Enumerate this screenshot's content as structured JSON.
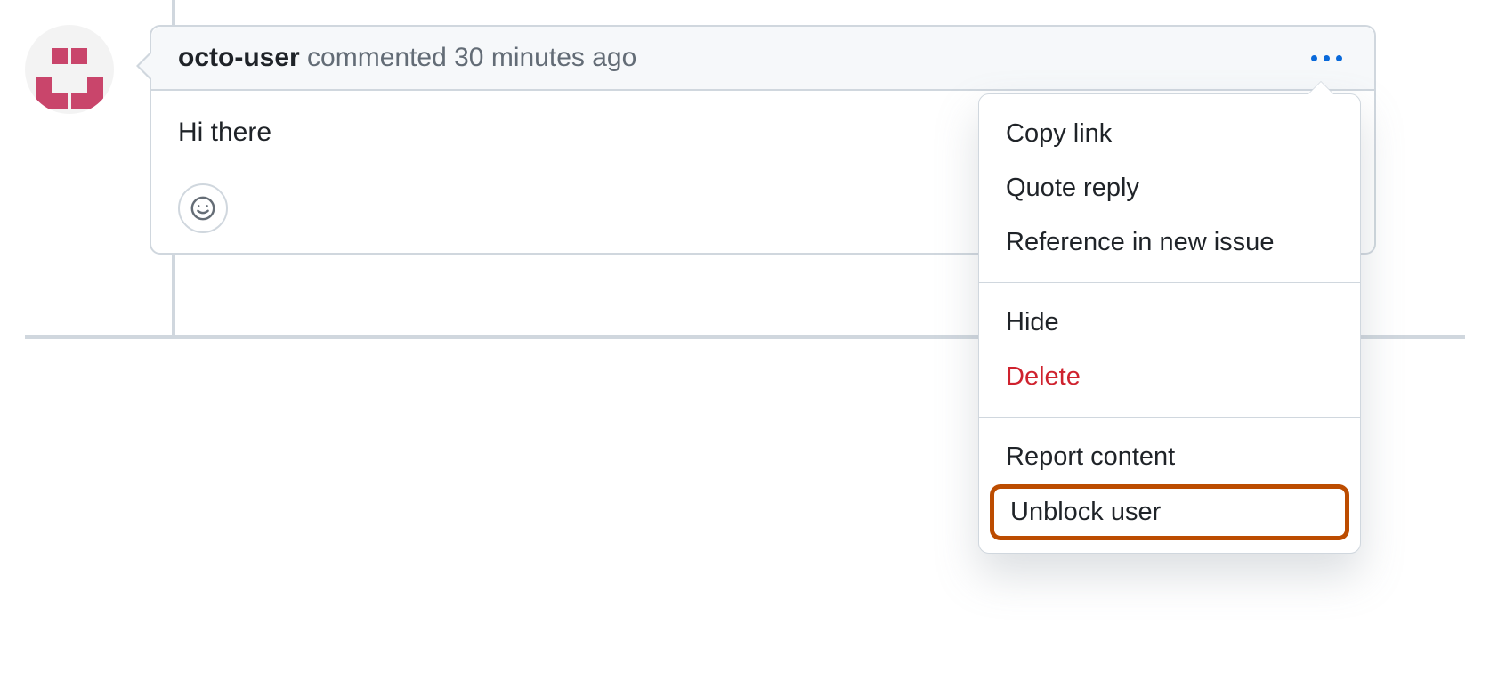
{
  "comment": {
    "username": "octo-user",
    "action_text": "commented",
    "timestamp": "30 minutes ago",
    "body": "Hi there"
  },
  "dropdown": {
    "copy_link": "Copy link",
    "quote_reply": "Quote reply",
    "reference_issue": "Reference in new issue",
    "hide": "Hide",
    "delete": "Delete",
    "report_content": "Report content",
    "unblock_user": "Unblock user"
  }
}
